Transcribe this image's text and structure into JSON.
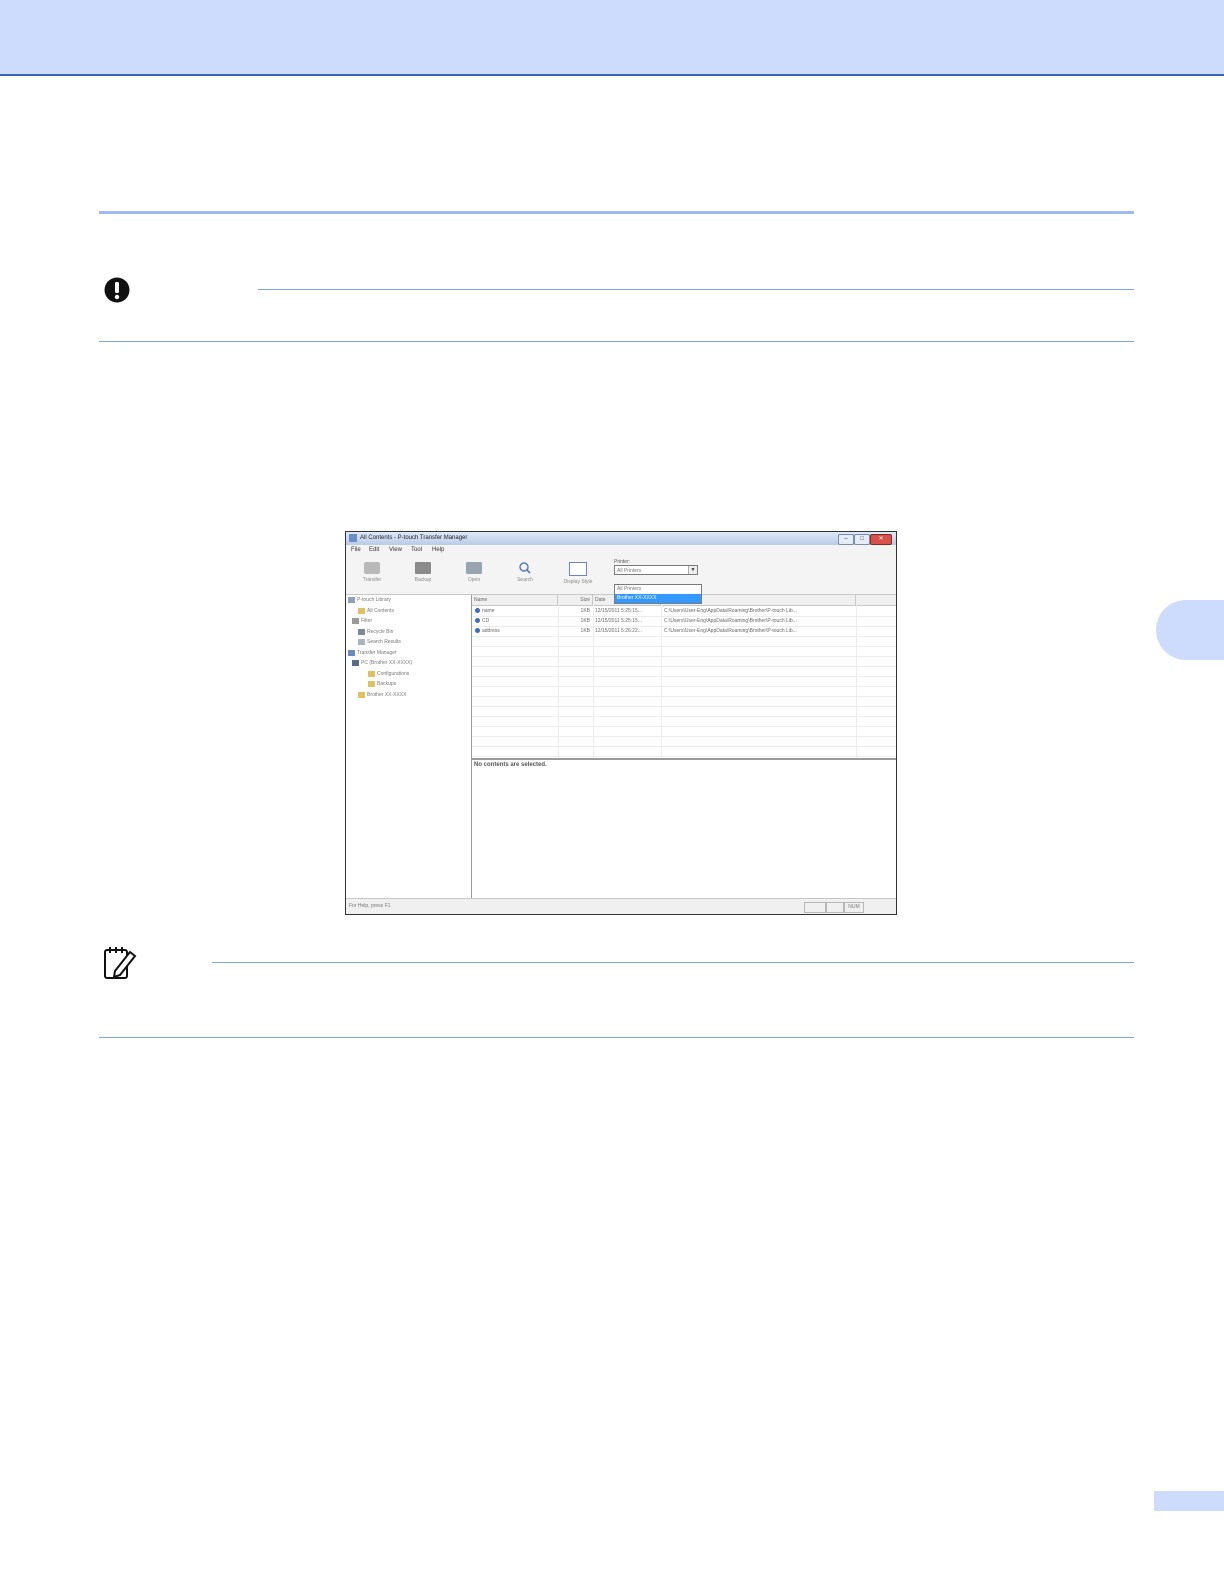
{
  "screenshot": {
    "window_title": "All Contents - P-touch Transfer Manager",
    "window_controls": [
      "–",
      "□",
      "✕"
    ],
    "menu": [
      "File",
      "Edit",
      "View",
      "Tool",
      "Help"
    ],
    "toolbar": [
      {
        "label": "Transfer",
        "icon": "transfer-icon"
      },
      {
        "label": "Backup",
        "icon": "backup-icon"
      },
      {
        "label": "Open",
        "icon": "open-folder-icon"
      },
      {
        "label": "Search",
        "icon": "search-icon"
      },
      {
        "label": "Display Style",
        "icon": "display-style-icon"
      }
    ],
    "printer": {
      "label": "Printer:",
      "value": "All Printers",
      "options": [
        "All Printers",
        "Brother XX-XXXX"
      ],
      "highlighted": "Brother XX-XXXX"
    },
    "tree": [
      "P-touch Library",
      "All Contents",
      "Filter",
      "Recycle Bin",
      "Search Results",
      "Transfer Manager",
      "PC (Brother XX-XXXX)",
      "Configurations",
      "Backups",
      "Brother XX-XXXX"
    ],
    "columns": [
      "Name",
      "Size",
      "Date",
      "Location"
    ],
    "rows": [
      {
        "name": "name",
        "size": "1KB",
        "date": "12/15/2011 5:25:15...",
        "location": "C:\\Users\\User-Eng\\AppData\\Roaming\\Brother\\P-touch Lib..."
      },
      {
        "name": "CD",
        "size": "1KB",
        "date": "12/15/2011 5:25:15...",
        "location": "C:\\Users\\User-Eng\\AppData\\Roaming\\Brother\\P-touch Lib..."
      },
      {
        "name": "address",
        "size": "1KB",
        "date": "12/15/2011 5:26:22...",
        "location": "C:\\Users\\User-Eng\\AppData\\Roaming\\Brother\\P-touch Lib..."
      }
    ],
    "detail_message": "No contents are selected.",
    "status_text": "For Help, press F1",
    "status_panes": [
      "",
      "",
      "NUM"
    ]
  }
}
